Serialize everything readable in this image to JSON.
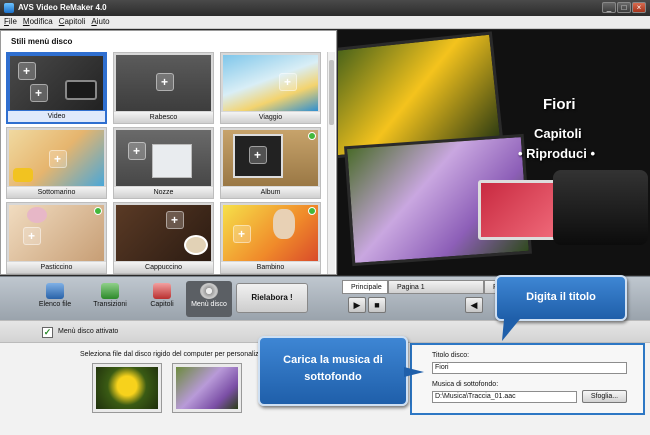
{
  "window": {
    "title": "AVS Video ReMaker 4.0",
    "min": "_",
    "max": "□",
    "close": "×"
  },
  "menu": [
    "File",
    "Modifica",
    "Capitoli",
    "Aiuto"
  ],
  "styles_panel": {
    "title": "Stili menù disco",
    "tiles": [
      "Video",
      "Rabesco",
      "Viaggio",
      "Sottomarino",
      "Nozze",
      "Album",
      "Pasticcino",
      "Cappuccino",
      "Bambino"
    ],
    "selected": "Video"
  },
  "preview": {
    "title": "Fiori",
    "item1": "Capitoli",
    "item2": "• Riproduci •"
  },
  "toolbar": {
    "file_list": "Elenco file",
    "transitions": "Transizioni",
    "chapters": "Capitoli",
    "disc_menu": "Menù disco",
    "rework": "Rielabora !",
    "page_tabs": [
      "Principale",
      "Pagina 1",
      "Pagi"
    ],
    "play": "▶",
    "stop": "■"
  },
  "settings": {
    "menu_enabled": "Menù disco attivato",
    "hint": "Seleziona file dal disco rigido del computer per personalizz",
    "disc_title_label": "Titolo disco:",
    "disc_title_value": "Fiori",
    "music_label": "Musica di sottofondo:",
    "music_value": "D:\\Musica\\Traccia_01.aac",
    "browse": "Sfoglia..."
  },
  "callouts": {
    "title_tip": "Digita il titolo",
    "music_tip": "Carica la musica di sottofondo"
  },
  "colors": {
    "accent": "#2d77c4",
    "selection": "#2f6fd0",
    "badge": "#42b83b"
  }
}
